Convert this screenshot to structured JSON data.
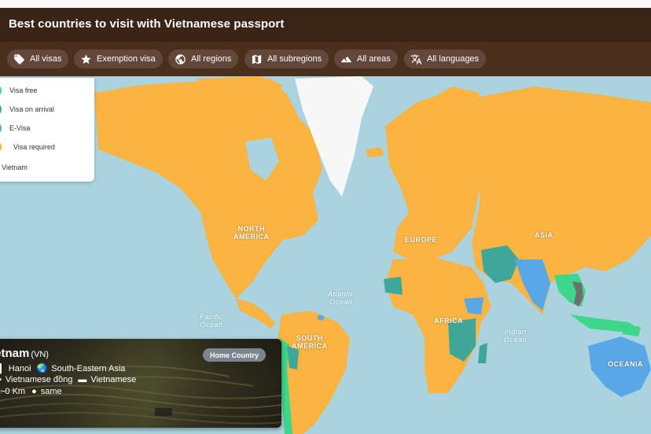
{
  "header": {
    "title": "Best countries to visit with Vietnamese passport"
  },
  "filters": [
    {
      "label": "All visas",
      "icon": "tag-icon"
    },
    {
      "label": "Exemption visa",
      "icon": "star-icon"
    },
    {
      "label": "All regions",
      "icon": "globe-icon"
    },
    {
      "label": "All subregions",
      "icon": "map-icon"
    },
    {
      "label": "All areas",
      "icon": "mountain-icon"
    },
    {
      "label": "All languages",
      "icon": "translate-icon"
    }
  ],
  "legend": {
    "items": [
      {
        "label": "Visa free",
        "color": "#3ed68a"
      },
      {
        "label": "Visa on arrival",
        "color": "#3fa79a"
      },
      {
        "label": "E-Visa",
        "color": "#5aa7e8"
      },
      {
        "label": "Visa required",
        "color": "#fbb441"
      }
    ],
    "home_label": "Vietnam",
    "home_color": "#6e6e6e"
  },
  "map": {
    "land_color": "#fbb441",
    "water_color": "#aad3df",
    "greenland_color": "#f7f7f7",
    "continents": {
      "north_america": "NORTH\nAMERICA",
      "europe": "EUROPE",
      "asia": "ASIA",
      "africa": "AFRICA",
      "south_america": "SOUTH\nAMERICA",
      "oceania": "OCEANIA"
    },
    "oceans": {
      "atlantic": "Atlantic\nOcean",
      "pacific": "Pacific\nOcean",
      "indian": "Indian\nOcean"
    }
  },
  "card": {
    "name": "ietnam",
    "code": "(VN)",
    "badge": "Home Country",
    "capital": "Hanoi",
    "subregion": "South-Eastern Asia",
    "currency": "Vietnamese đồng",
    "language": "Vietnamese",
    "distance": "~0 Km",
    "time": "same"
  }
}
